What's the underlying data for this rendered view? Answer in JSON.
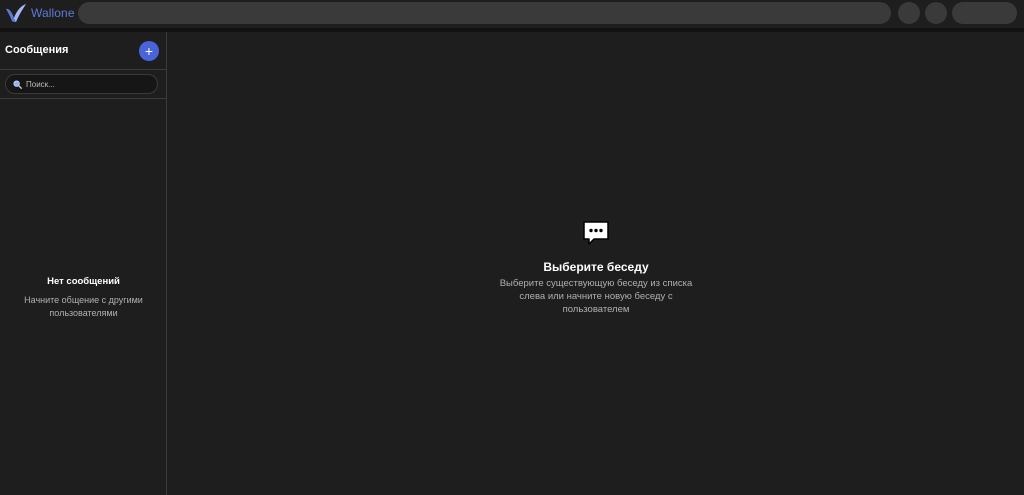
{
  "app": {
    "brand": "Wallone",
    "logo_icon": "wallone-logo-icon",
    "accent_color": "#4a63d8"
  },
  "sidebar": {
    "title": "Сообщения",
    "add_icon": "plus-icon",
    "add_label": "+",
    "search_placeholder": "Поиск...",
    "search_icon": "magnifier-icon",
    "empty_title": "Нет сообщений",
    "empty_subtitle": "Начните общение с другими пользователями"
  },
  "main": {
    "icon": "speech-bubble-icon",
    "title": "Выберите беседу",
    "subtitle": "Выберите существующую беседу из списка слева или начните новую беседу с пользователем"
  }
}
